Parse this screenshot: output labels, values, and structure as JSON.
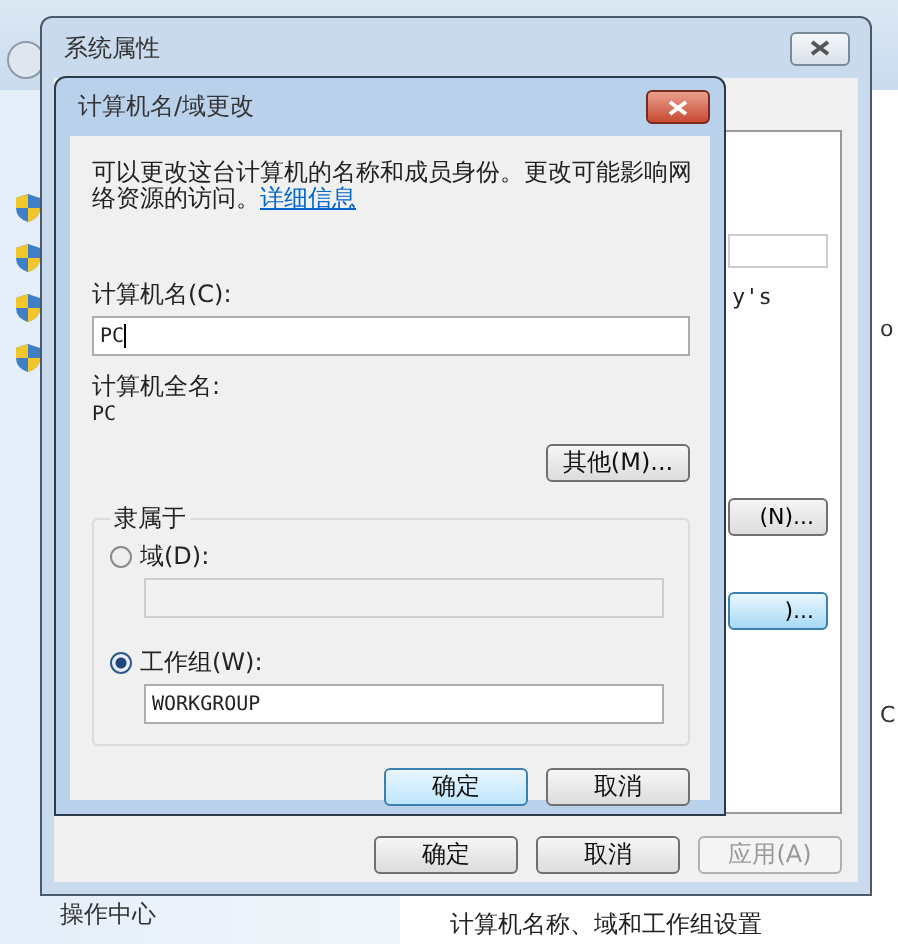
{
  "background": {
    "sidebar_items": [
      "操作中心"
    ],
    "footer_text": "计算机名称、域和工作组设置",
    "edge_texts": [
      "o",
      "C"
    ]
  },
  "system_properties": {
    "title": "系统属性",
    "partial_text": "y's",
    "partial_buttons": [
      {
        "label": "(N)...",
        "selected": false
      },
      {
        "label": ")...",
        "selected": true
      }
    ],
    "buttons": [
      {
        "label": "确定",
        "disabled": false
      },
      {
        "label": "取消",
        "disabled": false
      },
      {
        "label": "应用(A)",
        "disabled": true
      }
    ]
  },
  "dialog": {
    "title": "计算机名/域更改",
    "description": "可以更改这台计算机的名称和成员身份。更改可能影响网络资源的访问。",
    "link": "详细信息",
    "computer_name_label": "计算机名(C):",
    "computer_name": "PC",
    "full_name_label": "计算机全名:",
    "full_name": "PC",
    "more_button": "其他(M)...",
    "member_of": {
      "legend": "隶属于",
      "options": [
        {
          "label": "域(D):",
          "selected": false
        },
        {
          "label": "工作组(W):",
          "selected": true,
          "value": "WORKGROUP"
        }
      ]
    },
    "buttons": [
      {
        "label": "确定",
        "default": true
      },
      {
        "label": "取消",
        "default": false
      }
    ]
  }
}
